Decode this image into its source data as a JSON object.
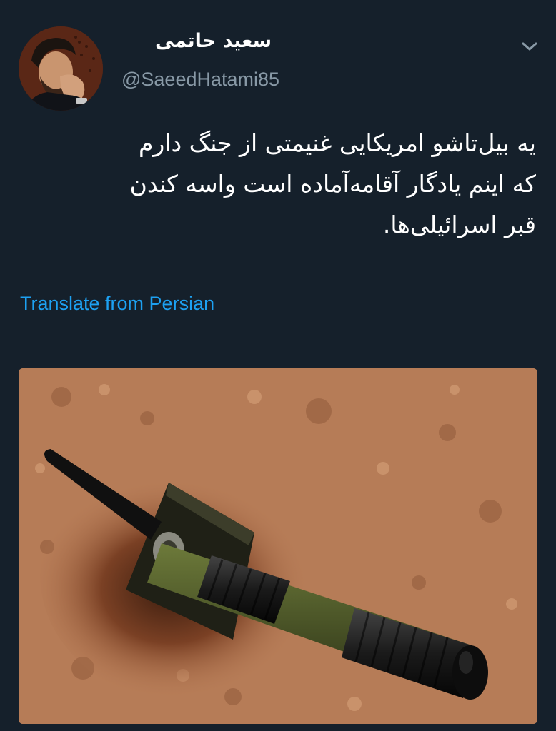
{
  "author": {
    "display_name": "سعید حاتمی",
    "handle": "@SaeedHatami85"
  },
  "tweet": {
    "lines": [
      "یه بیل‌تاشو امریکایی غنیمتی از جنگ دارم",
      "که اینم یادگار آقامه‌آماده است واسه کندن",
      "قبر اسرائیلی‌ها."
    ]
  },
  "actions": {
    "translate_label": "Translate from Persian"
  },
  "icons": {
    "menu": "chevron-down-icon"
  },
  "colors": {
    "background": "#15202b",
    "text": "#ffffff",
    "secondary": "#8899a6",
    "link": "#1da1f2"
  },
  "media": {
    "description_hidden": true
  }
}
